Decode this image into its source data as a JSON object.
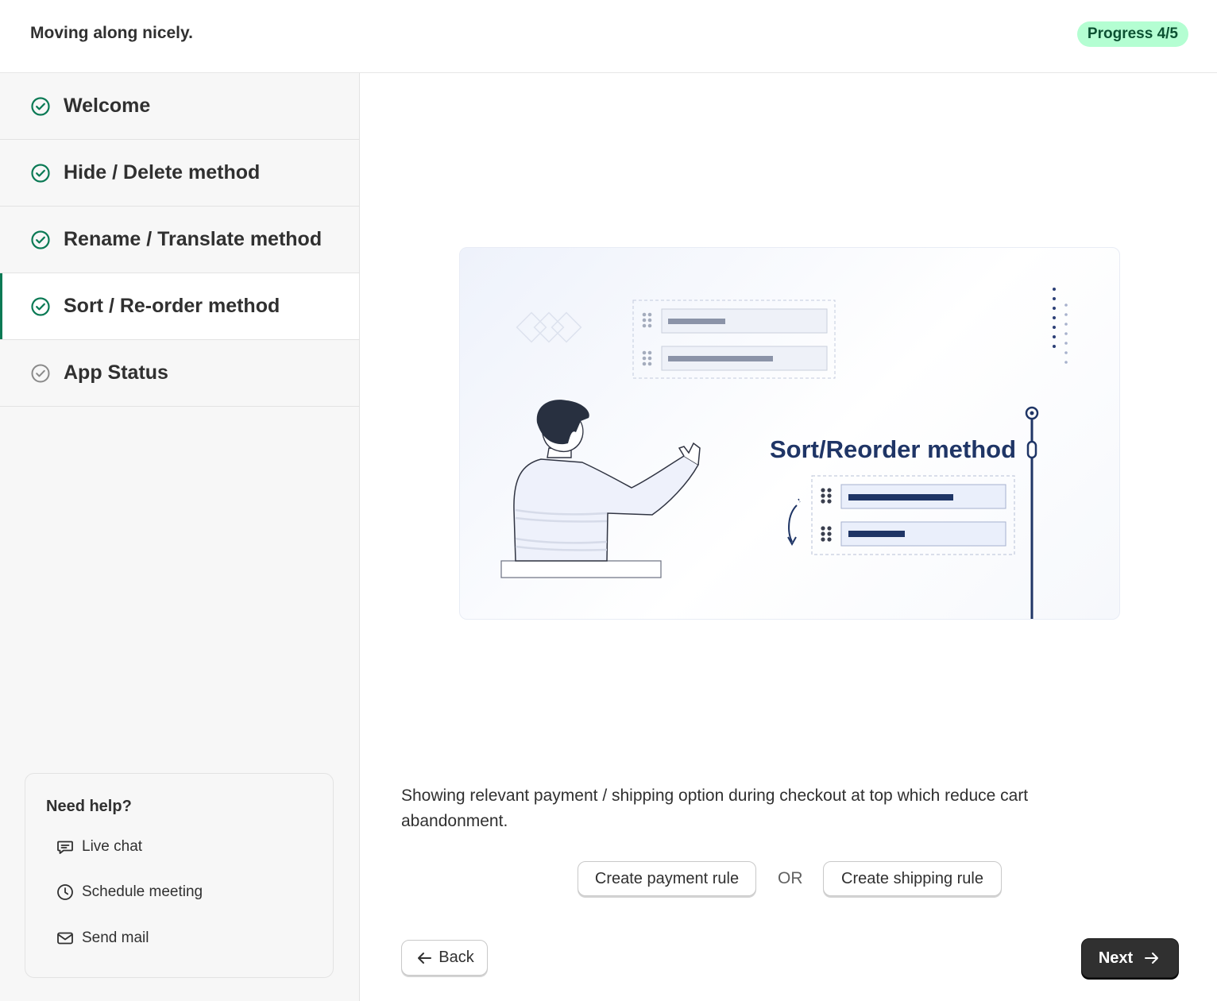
{
  "header": {
    "title": "Moving along nicely.",
    "progress_badge": "Progress 4/5"
  },
  "sidebar": {
    "steps": [
      {
        "label": "Welcome",
        "status": "complete"
      },
      {
        "label": "Hide / Delete method",
        "status": "complete"
      },
      {
        "label": "Rename / Translate method",
        "status": "complete"
      },
      {
        "label": "Sort / Re-order method",
        "status": "complete",
        "active": true
      },
      {
        "label": "App Status",
        "status": "pending"
      }
    ],
    "help": {
      "heading": "Need help?",
      "items": [
        {
          "label": "Live chat",
          "icon": "chat-icon"
        },
        {
          "label": "Schedule meeting",
          "icon": "clock-icon"
        },
        {
          "label": "Send mail",
          "icon": "mail-icon"
        }
      ]
    }
  },
  "main": {
    "illustration": {
      "heading": "Sort/Reorder method"
    },
    "description": "Showing relevant payment / shipping option during checkout at top which reduce cart abandonment.",
    "actions": {
      "payment_rule_label": "Create payment rule",
      "or_label": "OR",
      "shipping_rule_label": "Create shipping rule"
    },
    "nav": {
      "back_label": "Back",
      "next_label": "Next"
    }
  },
  "colors": {
    "accent_green": "#0b7a55",
    "badge_bg": "#b4fed2",
    "badge_text": "#0c5132",
    "navy": "#1f3566",
    "primary_button": "#303030"
  }
}
